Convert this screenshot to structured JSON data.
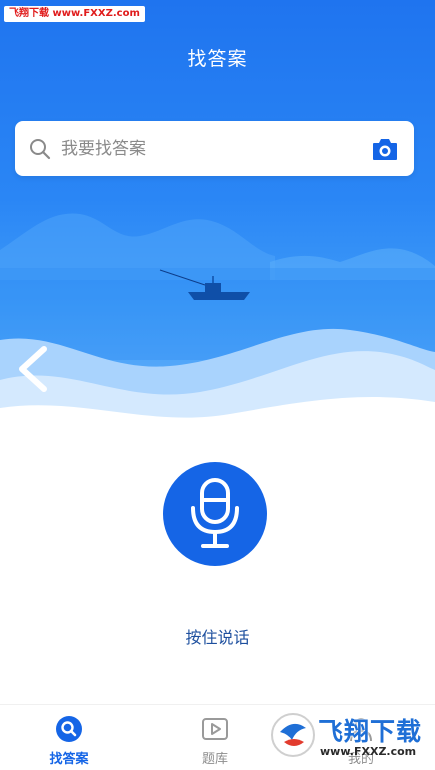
{
  "watermark": {
    "top_text": "飞翔下载 www.FXXZ.com",
    "logo_text": "飞翔下载",
    "logo_domain": "www.FXXZ.com"
  },
  "header": {
    "title": "找答案"
  },
  "search": {
    "placeholder": "我要找答案"
  },
  "voice": {
    "label": "按住说话"
  },
  "tabs": [
    {
      "label": "找答案",
      "active": true
    },
    {
      "label": "题库",
      "active": false
    },
    {
      "label": "我的",
      "active": false
    }
  ],
  "colors": {
    "primary": "#1565e6",
    "hero_top": "#1f74ef",
    "hero_bottom": "#6cb6fb",
    "label_text": "#1d4f9e",
    "tab_inactive": "#8d8d8d"
  },
  "icons": {
    "search": "search-icon",
    "camera": "camera-icon",
    "back": "chevron-left-icon",
    "mic": "microphone-icon",
    "tab_answer": "magnifier-icon",
    "tab_bank": "play-card-icon",
    "tab_mine": "person-icon"
  }
}
